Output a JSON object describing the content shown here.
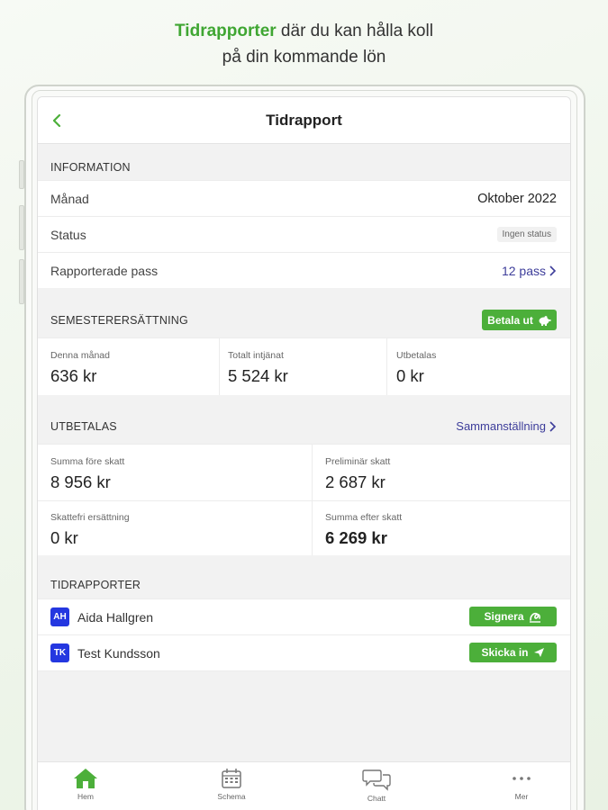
{
  "promo": {
    "highlight": "Tidrapporter",
    "rest_line1": " där du kan hålla koll",
    "line2": "på din kommande lön"
  },
  "header": {
    "title": "Tidrapport"
  },
  "information": {
    "heading": "INFORMATION",
    "rows": [
      {
        "label": "Månad",
        "value": "Oktober 2022"
      },
      {
        "label": "Status",
        "value": "Ingen status"
      },
      {
        "label": "Rapporterade pass",
        "value": "12 pass"
      }
    ]
  },
  "vacation": {
    "heading": "SEMESTERERSÄTTNING",
    "pay_button": "Betala ut",
    "cells": [
      {
        "label": "Denna månad",
        "value": "636 kr"
      },
      {
        "label": "Totalt intjänat",
        "value": "5 524 kr"
      },
      {
        "label": "Utbetalas",
        "value": "0 kr"
      }
    ]
  },
  "payout": {
    "heading": "UTBETALAS",
    "summary_link": "Sammanställning",
    "cells": [
      {
        "label": "Summa före skatt",
        "value": "8 956 kr"
      },
      {
        "label": "Preliminär skatt",
        "value": "2 687 kr"
      },
      {
        "label": "Skattefri ersättning",
        "value": "0 kr"
      },
      {
        "label": "Summa efter skatt",
        "value": "6 269 kr"
      }
    ]
  },
  "timesheets": {
    "heading": "TIDRAPPORTER",
    "items": [
      {
        "initials": "AH",
        "name": "Aida Hallgren",
        "action": "Signera"
      },
      {
        "initials": "TK",
        "name": "Test Kundsson",
        "action": "Skicka in"
      }
    ]
  },
  "tabs": [
    {
      "label": "Hem",
      "icon": "home-icon"
    },
    {
      "label": "Schema",
      "icon": "calendar-icon"
    },
    {
      "label": "Chatt",
      "icon": "chat-icon"
    },
    {
      "label": "Mer",
      "icon": "more-icon"
    }
  ],
  "colors": {
    "accent": "#4caf3a",
    "link": "#3d3d9a",
    "avatar": "#2437e0"
  }
}
